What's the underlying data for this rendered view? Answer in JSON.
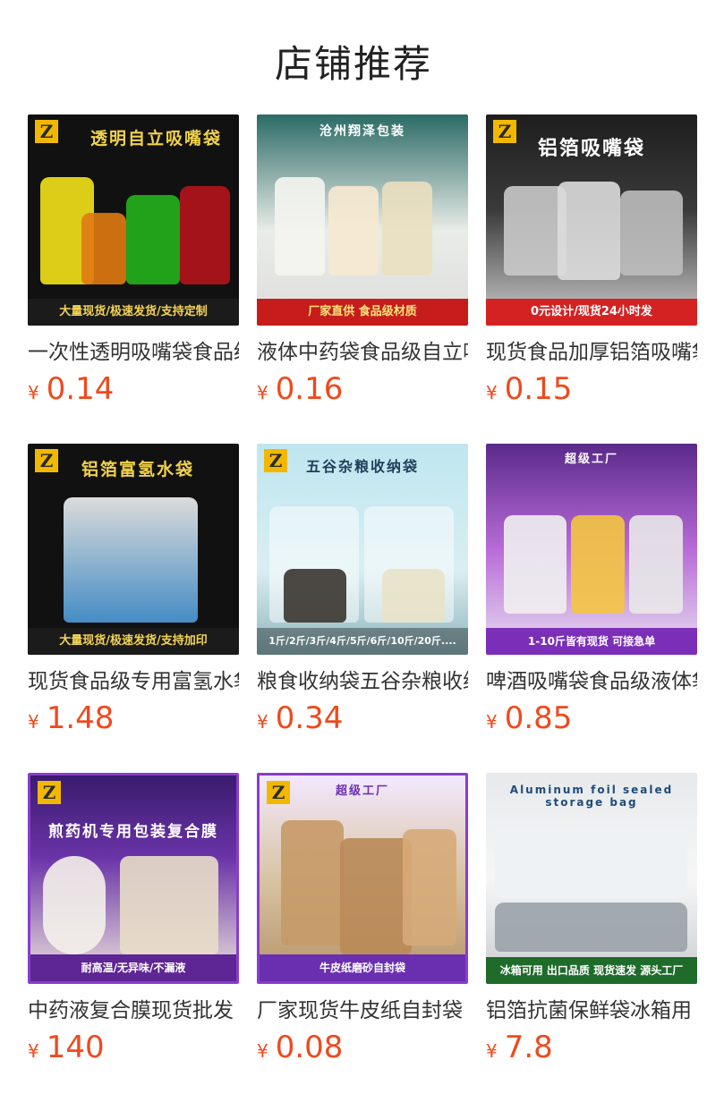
{
  "page_title": "店铺推荐",
  "currency": "¥",
  "products": [
    {
      "name": "一次性透明吸嘴袋食品级自立吸嘴袋",
      "price": "0.14",
      "image": {
        "headline": "透明自立吸嘴袋",
        "footer": "大量现货/极速发货/支持定制"
      }
    },
    {
      "name": "液体中药袋食品级自立吸嘴袋",
      "price": "0.16",
      "image": {
        "headline": "沧州翔泽包装",
        "footer": "厂家直供 食品级材质"
      }
    },
    {
      "name": "现货食品加厚铝箔吸嘴袋",
      "price": "0.15",
      "image": {
        "headline": "铝箔吸嘴袋",
        "footer": "0元设计/现货24小时发"
      }
    },
    {
      "name": "现货食品级专用富氢水袋",
      "price": "1.48",
      "image": {
        "headline": "铝箔富氢水袋",
        "footer": "大量现货/极速发货/支持加印"
      }
    },
    {
      "name": "粮食收纳袋五谷杂粮收纳袋",
      "price": "0.34",
      "image": {
        "headline": "五谷杂粮收纳袋",
        "footer": "1斤/2斤/3斤/4斤/5斤/6斤/10斤/20斤...."
      }
    },
    {
      "name": "啤酒吸嘴袋食品级液体袋",
      "price": "0.85",
      "image": {
        "headline": "超级工厂",
        "footer": "1-10斤皆有现货 可接急单"
      }
    },
    {
      "name": "中药液复合膜现货批发",
      "price": "140",
      "image": {
        "headline": "煎药机专用包装复合膜",
        "footer": "耐高温/无异味/不漏液"
      }
    },
    {
      "name": "厂家现货牛皮纸自封袋",
      "price": "0.08",
      "image": {
        "headline": "超级工厂",
        "footer": "牛皮纸磨砂自封袋"
      }
    },
    {
      "name": "铝箔抗菌保鲜袋冰箱用",
      "price": "7.8",
      "image": {
        "headline": "Aluminum foil sealed storage bag",
        "footer": "冰箱可用 出口品质 现货速发 源头工厂"
      }
    }
  ]
}
